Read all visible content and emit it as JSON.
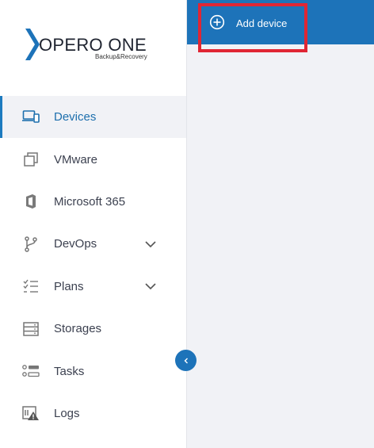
{
  "brand": {
    "name": "OPERO ONE",
    "tagline": "Backup&Recovery",
    "accent": "#1d73b9"
  },
  "toolbar": {
    "add_device_label": "Add device",
    "add_device_icon": "plus-circle-icon"
  },
  "sidebar": {
    "items": [
      {
        "label": "Devices",
        "icon": "devices-icon",
        "active": true
      },
      {
        "label": "VMware",
        "icon": "vmware-icon"
      },
      {
        "label": "Microsoft 365",
        "icon": "office-icon"
      },
      {
        "label": "DevOps",
        "icon": "branch-icon",
        "expandable": true
      },
      {
        "label": "Plans",
        "icon": "checklist-icon",
        "expandable": true
      },
      {
        "label": "Storages",
        "icon": "storage-icon"
      },
      {
        "label": "Tasks",
        "icon": "tasks-icon"
      },
      {
        "label": "Logs",
        "icon": "logs-warning-icon"
      }
    ],
    "collapse_icon": "chevron-left-icon"
  }
}
